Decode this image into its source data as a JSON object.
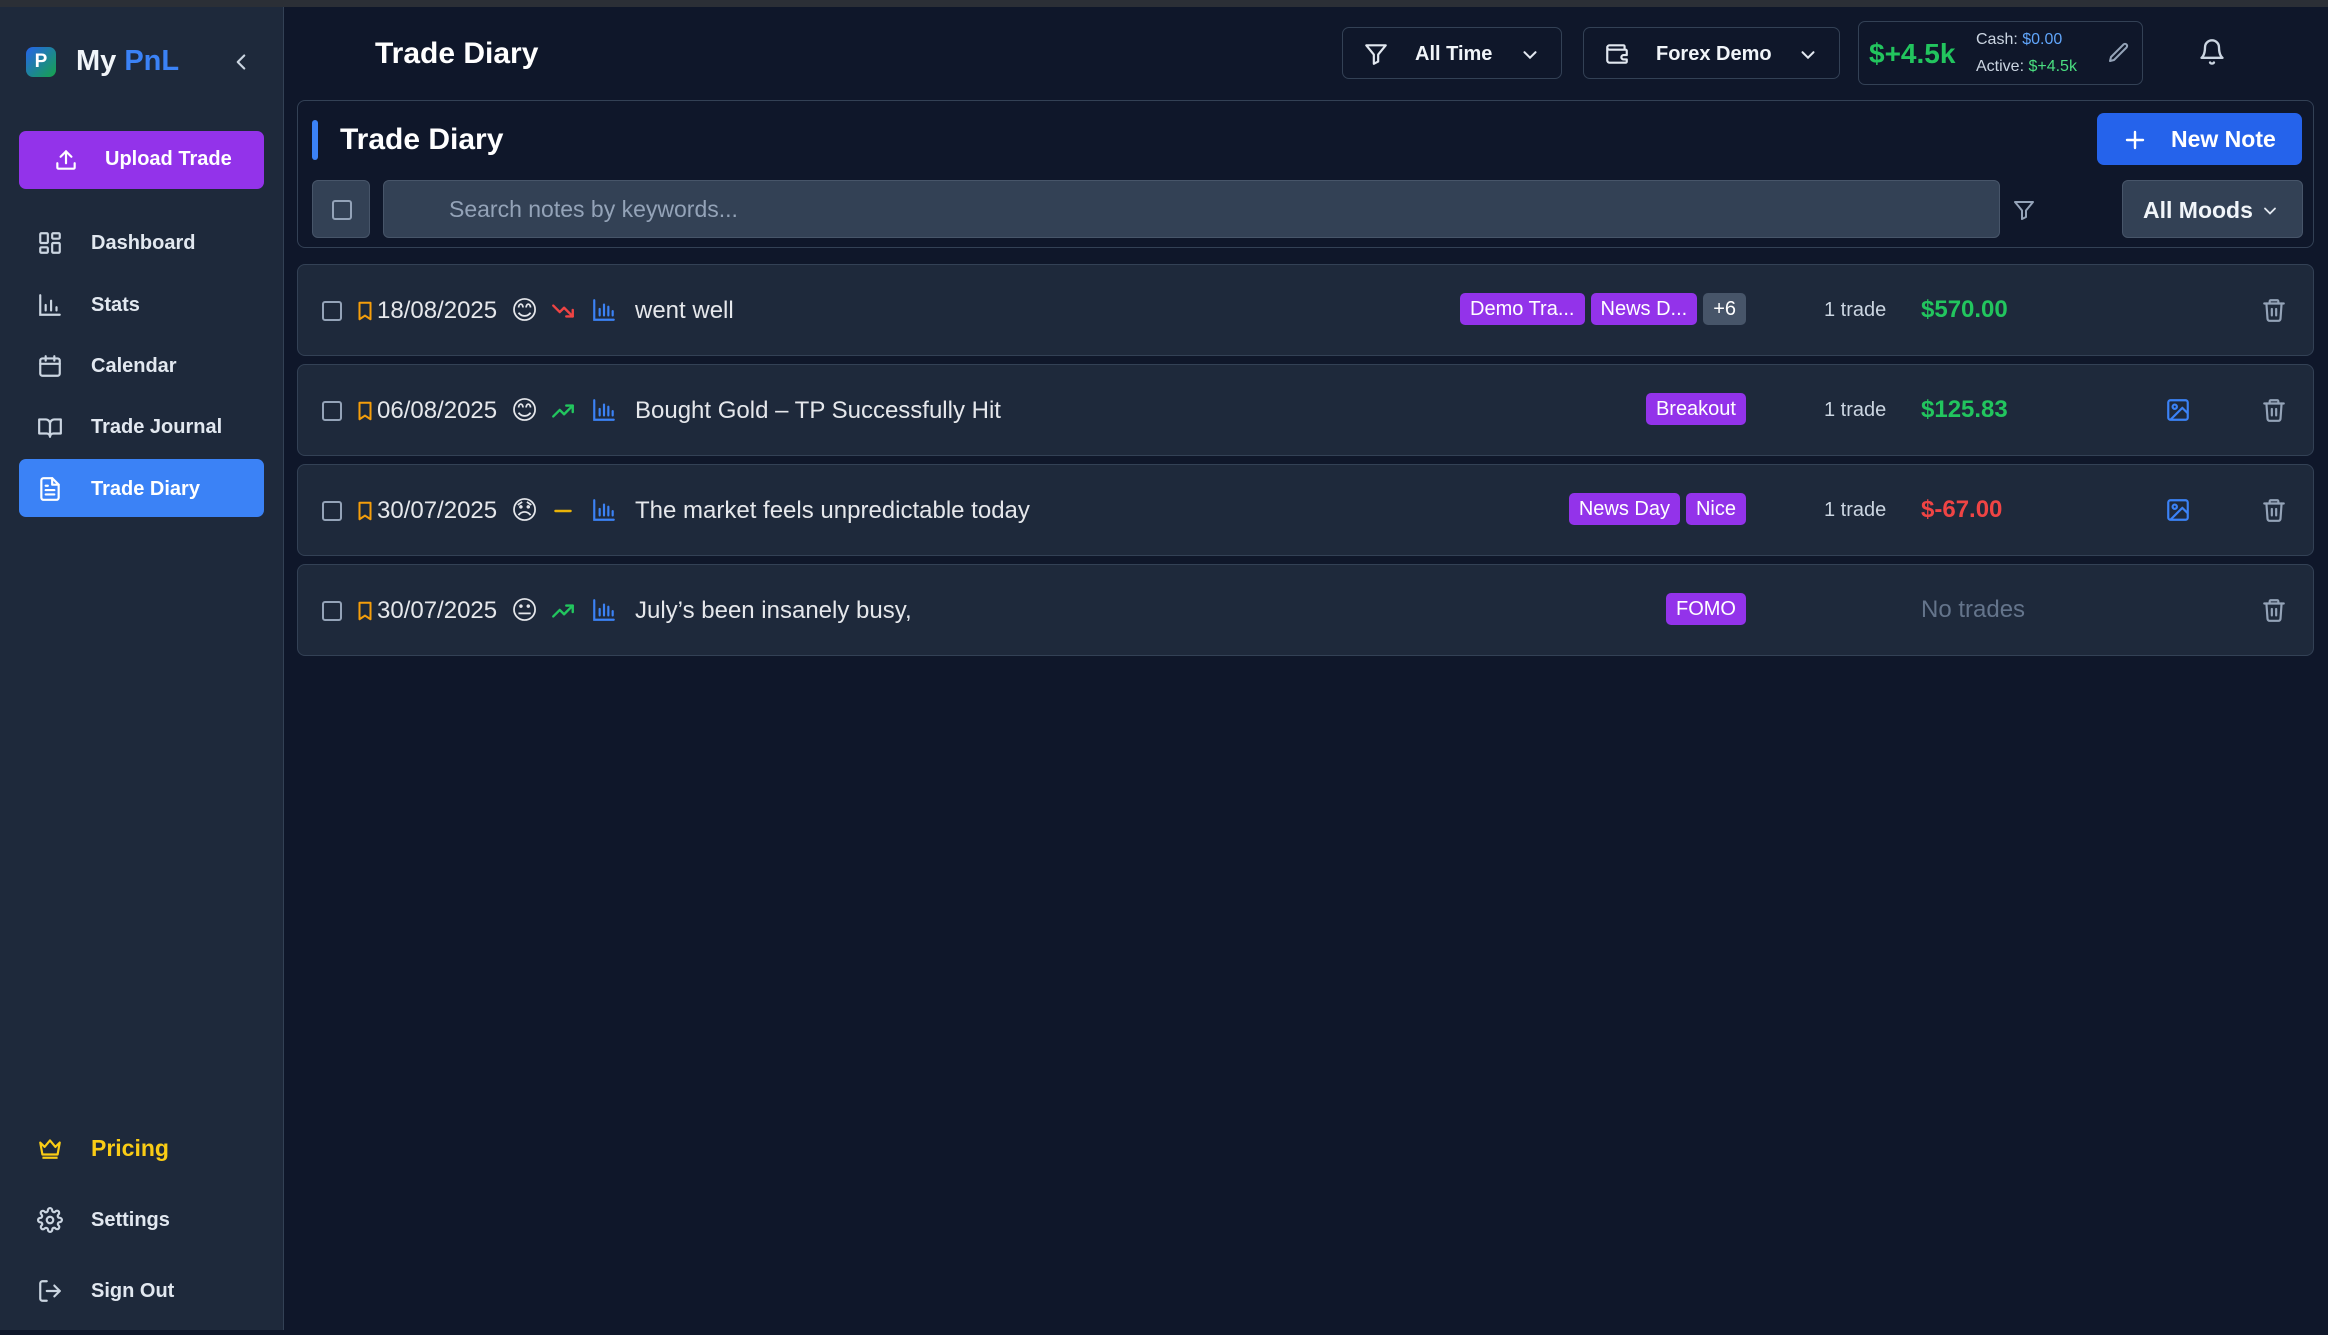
{
  "app": {
    "brand_prefix": "My ",
    "brand_accent": "PnL",
    "logo_letter": "P"
  },
  "sidebar": {
    "upload_label": "Upload Trade",
    "items": [
      {
        "label": "Dashboard",
        "icon": "dashboard-icon"
      },
      {
        "label": "Stats",
        "icon": "bar-chart-icon"
      },
      {
        "label": "Calendar",
        "icon": "calendar-icon"
      },
      {
        "label": "Trade Journal",
        "icon": "book-icon"
      },
      {
        "label": "Trade Diary",
        "icon": "document-icon",
        "active": true
      }
    ],
    "bottom": [
      {
        "label": "Pricing",
        "icon": "crown-icon"
      },
      {
        "label": "Settings",
        "icon": "gear-icon"
      },
      {
        "label": "Sign Out",
        "icon": "sign-out-icon"
      }
    ]
  },
  "header": {
    "title": "Trade Diary",
    "time_filter": "All Time",
    "account": "Forex Demo",
    "balance": "$+4.5k",
    "cash_label": "Cash:",
    "cash_value": "$0.00",
    "active_label": "Active:",
    "active_value": "$+4.5k"
  },
  "panel": {
    "title": "Trade Diary",
    "new_note_label": "New Note",
    "search_placeholder": "Search notes by keywords...",
    "mood_filter": "All Moods"
  },
  "notes": [
    {
      "date": "18/08/2025",
      "mood": "😊",
      "trend": "down",
      "title": "went well",
      "tags": [
        "Demo Tra...",
        "News D..."
      ],
      "more": "+6",
      "trades": "1 trade",
      "pnl": "$570.00",
      "pnl_state": "positive",
      "has_image": false
    },
    {
      "date": "06/08/2025",
      "mood": "😊",
      "trend": "up",
      "title": "Bought Gold – TP Successfully Hit",
      "tags": [
        "Breakout"
      ],
      "more": "",
      "trades": "1 trade",
      "pnl": "$125.83",
      "pnl_state": "positive",
      "has_image": true
    },
    {
      "date": "30/07/2025",
      "mood": "😞",
      "trend": "flat",
      "title": "The market feels unpredictable today",
      "tags": [
        "News Day",
        "Nice"
      ],
      "more": "",
      "trades": "1 trade",
      "pnl": "$-67.00",
      "pnl_state": "negative",
      "has_image": true
    },
    {
      "date": "30/07/2025",
      "mood": "😐",
      "trend": "up",
      "title": "July’s been insanely busy,",
      "tags": [
        "FOMO"
      ],
      "more": "",
      "trades": "",
      "pnl": "No trades",
      "pnl_state": "none",
      "has_image": false
    }
  ],
  "colors": {
    "background": "#0f172a",
    "surface": "#1e293b",
    "accent": "#3b82f6",
    "upload": "#9333ea",
    "positive": "#22c55e",
    "negative": "#ef4444",
    "pricing": "#facc15"
  }
}
